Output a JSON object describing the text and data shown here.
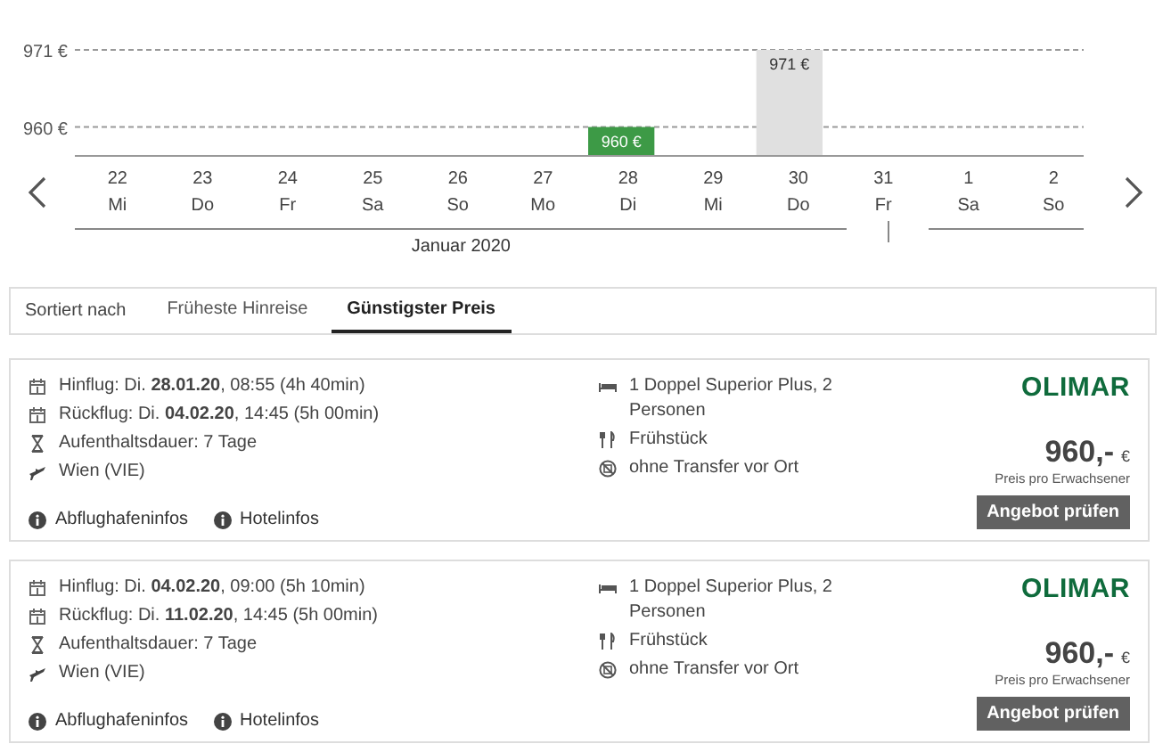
{
  "price_chart": {
    "chart_data": {
      "type": "bar",
      "categories": [
        "22",
        "23",
        "24",
        "25",
        "26",
        "27",
        "28",
        "29",
        "30",
        "31",
        "1",
        "2"
      ],
      "series": [
        {
          "color": "#3d9a46",
          "values": [
            null,
            null,
            null,
            null,
            null,
            null,
            960,
            null,
            null,
            null,
            null,
            null
          ]
        },
        {
          "color": "#e0e0e0",
          "values": [
            null,
            null,
            null,
            null,
            null,
            null,
            null,
            null,
            971,
            null,
            null,
            null
          ]
        }
      ],
      "value_labels": [
        null,
        null,
        null,
        null,
        null,
        null,
        "960 €",
        null,
        "971 €",
        null,
        null,
        null
      ],
      "ylim": [
        956,
        971
      ],
      "yticks": [
        {
          "value": 971,
          "label": "971 €"
        },
        {
          "value": 960,
          "label": "960 €"
        }
      ]
    },
    "months": [
      {
        "label": "Januar 2020",
        "weekdays": [
          "Mi",
          "Do",
          "Fr",
          "Sa",
          "So",
          "Mo",
          "Di",
          "Mi",
          "Do",
          "Fr"
        ]
      },
      {
        "weekdays": [
          "Sa",
          "So"
        ]
      }
    ]
  },
  "sort": {
    "label": "Sortiert nach",
    "tabs": [
      {
        "label": "Früheste Hinreise",
        "selected": false
      },
      {
        "label": "Günstigster Preis",
        "selected": true
      }
    ]
  },
  "offers": [
    {
      "flight": [
        {
          "kind": "calendar",
          "text": "Hinflug: Di. **28.01.20**, 08:55 (4h 40min)"
        },
        {
          "kind": "calendar",
          "text": "Rückflug: Di. **04.02.20**, 14:45 (5h 00min)"
        },
        {
          "kind": "hourglass",
          "text": "Aufenthaltsdauer: 7 Tage"
        },
        {
          "kind": "plane",
          "text": "Wien (VIE)"
        }
      ],
      "hotel": [
        {
          "kind": "bed",
          "text": "1 Doppel Superior Plus, 2 Personen"
        },
        {
          "kind": "cutlery",
          "text": "Frühstück"
        },
        {
          "kind": "no-transfer",
          "text": "ohne Transfer vor Ort"
        }
      ],
      "links": [
        "Abflughafeninfos",
        "Hotelinfos"
      ],
      "brand": "OLIMAR",
      "price": "960,-",
      "currency": "€",
      "price_note": "Preis pro Erwachsener",
      "button": "Angebot prüfen"
    },
    {
      "flight": [
        {
          "kind": "calendar",
          "text": "Hinflug: Di. **04.02.20**, 09:00 (5h 10min)"
        },
        {
          "kind": "calendar",
          "text": "Rückflug: Di. **11.02.20**, 14:45 (5h 00min)"
        },
        {
          "kind": "hourglass",
          "text": "Aufenthaltsdauer: 7 Tage"
        },
        {
          "kind": "plane",
          "text": "Wien (VIE)"
        }
      ],
      "hotel": [
        {
          "kind": "bed",
          "text": "1 Doppel Superior Plus, 2 Personen"
        },
        {
          "kind": "cutlery",
          "text": "Frühstück"
        },
        {
          "kind": "no-transfer",
          "text": "ohne Transfer vor Ort"
        }
      ],
      "links": [
        "Abflughafeninfos",
        "Hotelinfos"
      ],
      "brand": "OLIMAR",
      "price": "960,-",
      "currency": "€",
      "price_note": "Preis pro Erwachsener",
      "button": "Angebot prüfen"
    }
  ]
}
